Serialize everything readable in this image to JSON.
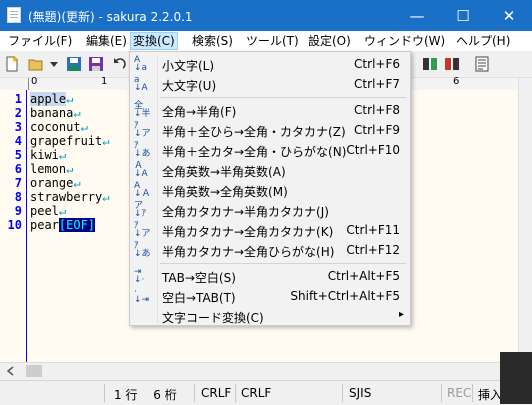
{
  "window": {
    "title": "(無題)(更新) - sakura 2.2.0.1",
    "minimize_glyph": "—",
    "maximize_glyph": "☐",
    "close_glyph": "✕"
  },
  "menubar": {
    "items": [
      {
        "label": "ファイル(F)"
      },
      {
        "label": "編集(E)"
      },
      {
        "label": "変換(C)"
      },
      {
        "label": "検索(S)"
      },
      {
        "label": "ツール(T)"
      },
      {
        "label": "設定(O)"
      },
      {
        "label": "ウィンドウ(W)"
      },
      {
        "label": "ヘルプ(H)"
      }
    ]
  },
  "ruler": {
    "labels": [
      "0",
      "1",
      "6"
    ]
  },
  "editor": {
    "line_numbers": [
      "1",
      "2",
      "3",
      "4",
      "5",
      "6",
      "7",
      "8",
      "9",
      "10"
    ],
    "lines": [
      "apple",
      "banana",
      "coconut",
      "grapefruit",
      "kiwi",
      "lemon",
      "orange",
      "strawberry",
      "peel",
      "pear"
    ],
    "crlf_glyph": "↵",
    "eof_marker": "[EOF]"
  },
  "dropdown": {
    "items": [
      {
        "label": "小文字(L)",
        "shortcut": "Ctrl+F6"
      },
      {
        "label": "大文字(U)",
        "shortcut": "Ctrl+F7"
      },
      {
        "label": "全角→半角(F)",
        "shortcut": "Ctrl+F8"
      },
      {
        "label": "半角＋全ひら→全角・カタカナ(Z)",
        "shortcut": "Ctrl+F9"
      },
      {
        "label": "半角＋全カタ→全角・ひらがな(N)",
        "shortcut": "Ctrl+F10"
      },
      {
        "label": "全角英数→半角英数(A)",
        "shortcut": ""
      },
      {
        "label": "半角英数→全角英数(M)",
        "shortcut": ""
      },
      {
        "label": "全角カタカナ→半角カタカナ(J)",
        "shortcut": ""
      },
      {
        "label": "半角カタカナ→全角カタカナ(K)",
        "shortcut": "Ctrl+F11"
      },
      {
        "label": "半角カタカナ→全角ひらがな(H)",
        "shortcut": "Ctrl+F12"
      },
      {
        "label": "TAB→空白(S)",
        "shortcut": "Ctrl+Alt+F5"
      },
      {
        "label": "空白→TAB(T)",
        "shortcut": "Shift+Ctrl+Alt+F5"
      },
      {
        "label": "文字コード変換(C)",
        "shortcut": "",
        "submenu_arrow": "▸"
      }
    ]
  },
  "statusbar": {
    "position": "1 行　 6 桁",
    "newline1": "CRLF",
    "newline2": "CRLF",
    "encoding": "SJIS",
    "rec": "REC",
    "mode": "挿入"
  }
}
